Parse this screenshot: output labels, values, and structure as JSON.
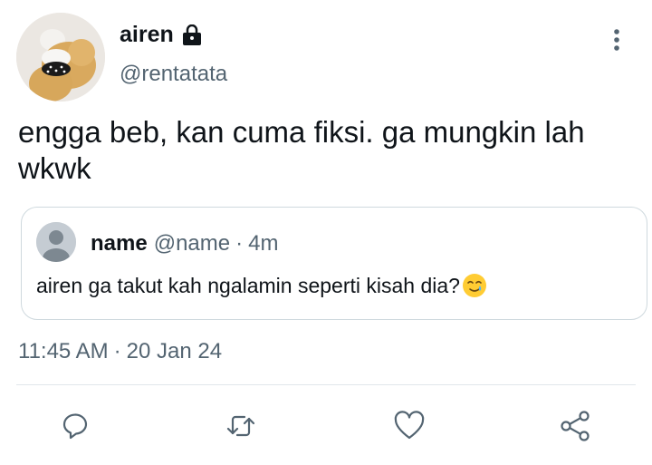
{
  "author": {
    "display_name": "airen",
    "handle": "@rentatata",
    "avatar_icon": "teddy-bear-avatar-icon",
    "protected_icon": "lock-icon"
  },
  "menu_icon": "more-vertical-icon",
  "tweet": {
    "text": "engga beb, kan cuma fiksi. ga mungkin lah wkwk"
  },
  "quote": {
    "name": "name",
    "handle": "@name",
    "separator": "·",
    "time": "4m",
    "text": "airen ga takut kah ngalamin seperti kisah dia?",
    "emoji_icon": "smiling-face-with-tear-icon"
  },
  "timestamp": {
    "time": "11:45 AM",
    "separator": "·",
    "date": "20 Jan 24"
  },
  "actions": [
    {
      "icon": "reply-icon"
    },
    {
      "icon": "retweet-icon"
    },
    {
      "icon": "like-icon"
    },
    {
      "icon": "share-icon"
    }
  ],
  "colors": {
    "primary_text": "#0f1419",
    "secondary_text": "#536471",
    "border": "#cfd9de",
    "icon": "#536471"
  }
}
